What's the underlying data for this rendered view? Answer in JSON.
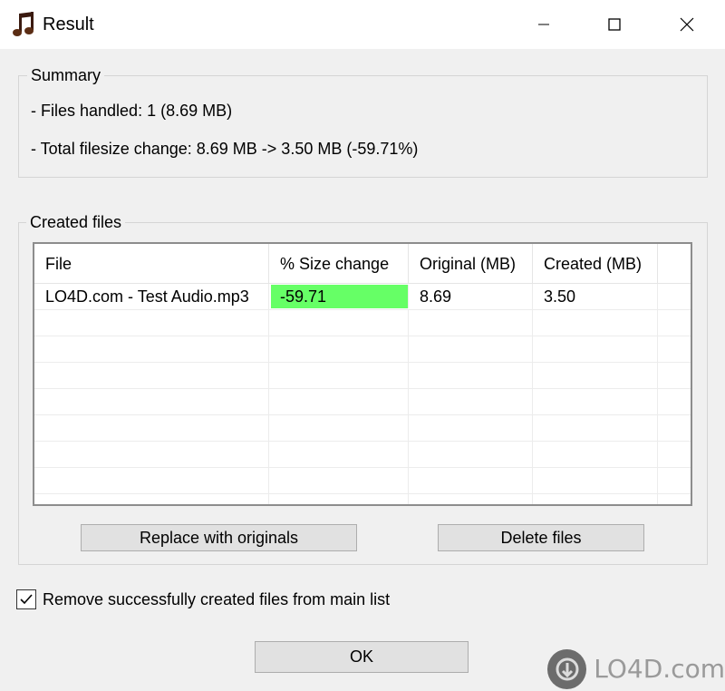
{
  "window": {
    "title": "Result",
    "icon": "music-note-icon"
  },
  "summary": {
    "label": "Summary",
    "files_handled": "- Files handled: 1  (8.69 MB)",
    "size_change": "- Total filesize change: 8.69 MB -> 3.50 MB  (-59.71%)"
  },
  "created_files": {
    "label": "Created files",
    "columns": [
      "File",
      "% Size change",
      "Original  (MB)",
      "Created  (MB)"
    ],
    "rows": [
      {
        "file": "LO4D.com - Test Audio.mp3",
        "size_change": "-59.71",
        "original": "8.69",
        "created": "3.50"
      }
    ],
    "highlight_color": "#66ff66"
  },
  "buttons": {
    "replace": "Replace with originals",
    "delete": "Delete files",
    "ok": "OK"
  },
  "checkbox": {
    "label": "Remove successfully created files from main list",
    "checked": true
  },
  "watermark": {
    "text": "LO4D.com"
  }
}
